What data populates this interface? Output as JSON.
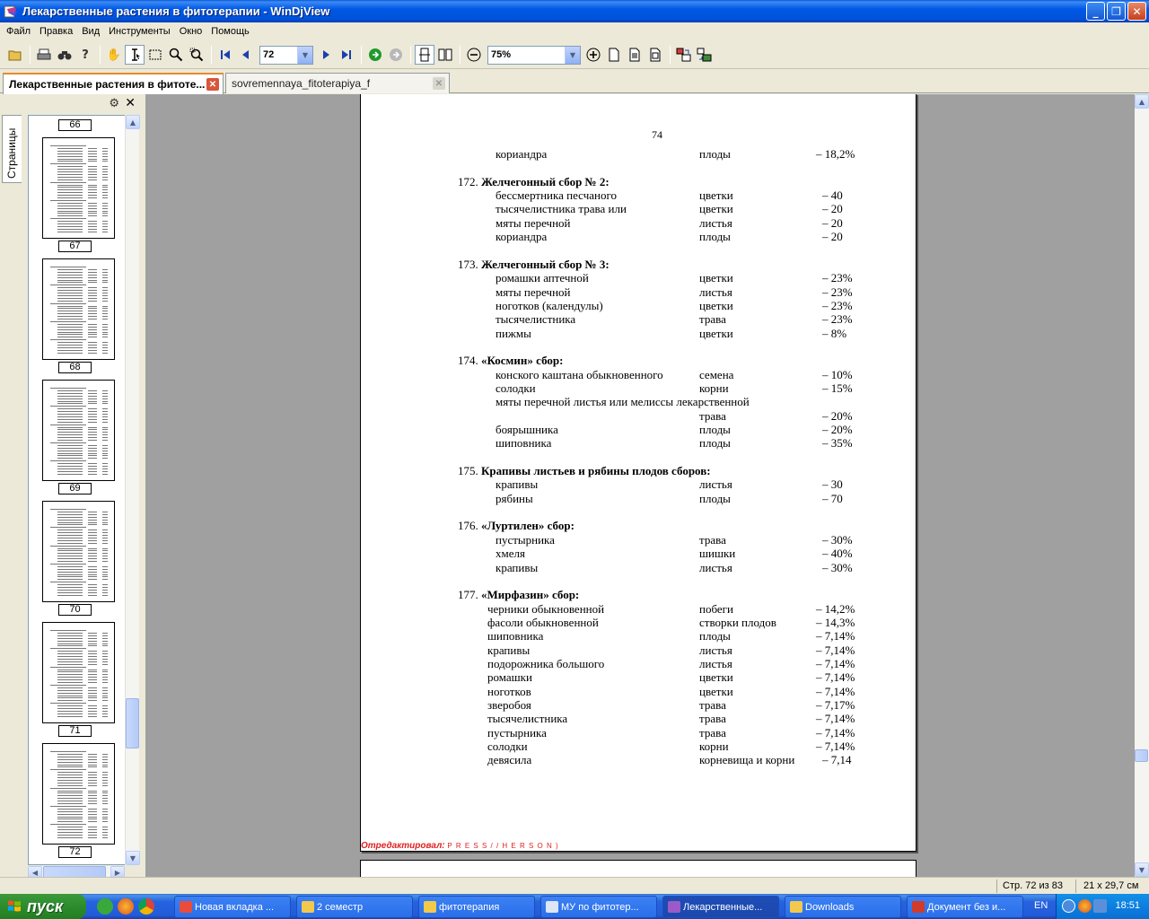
{
  "window": {
    "title": "Лекарственные растения в фитотерапии - WinDjView",
    "minimize": "_",
    "maximize": "❐",
    "close": "✕"
  },
  "menu": [
    "Файл",
    "Правка",
    "Вид",
    "Инструменты",
    "Окно",
    "Помощь"
  ],
  "toolbar": {
    "page_value": "72",
    "zoom_value": "75%"
  },
  "tabs": [
    {
      "label": "Лекарственные растения в фитоте...",
      "active": true
    },
    {
      "label": "sovremennaya_fitoterapiya_f",
      "active": false
    }
  ],
  "sidebar": {
    "tab_label": "Страницы",
    "thumbnails": [
      "66",
      "67",
      "68",
      "69",
      "70",
      "71",
      "72"
    ]
  },
  "document": {
    "page_number": "74",
    "sections": [
      {
        "heading": null,
        "items": [
          {
            "name": "кориандра",
            "part": "плоды",
            "amount": "– 18,2%"
          }
        ]
      },
      {
        "heading_num": "172.",
        "heading": "Желчегонный сбор № 2:",
        "items": [
          {
            "name": "бессмертника песчаного",
            "part": "цветки",
            "amount": "– 40"
          },
          {
            "name": "тысячелистника трава или",
            "part": "цветки",
            "amount": "– 20"
          },
          {
            "name": "мяты перечной",
            "part": "листья",
            "amount": "– 20"
          },
          {
            "name": "кориандра",
            "part": "плоды",
            "amount": "– 20"
          }
        ]
      },
      {
        "heading_num": "173.",
        "heading": "Желчегонный сбор № 3:",
        "items": [
          {
            "name": "ромашки аптечной",
            "part": "цветки",
            "amount": "– 23%"
          },
          {
            "name": "мяты перечной",
            "part": "листья",
            "amount": "– 23%"
          },
          {
            "name": "ноготков (календулы)",
            "part": "цветки",
            "amount": "– 23%"
          },
          {
            "name": "тысячелистника",
            "part": "трава",
            "amount": "– 23%"
          },
          {
            "name": "пижмы",
            "part": "цветки",
            "amount": "– 8%"
          }
        ]
      },
      {
        "heading_num": "174.",
        "heading": "«Космин» сбор:",
        "items": [
          {
            "name": "конского каштана обыкновенного",
            "part": "семена",
            "amount": "– 10%"
          },
          {
            "name": "солодки",
            "part": "корни",
            "amount": "– 15%"
          },
          {
            "name": "мяты перечной листья или мелиссы лекарственной",
            "part": "",
            "amount": ""
          },
          {
            "name": "",
            "part": "трава",
            "amount": "– 20%"
          },
          {
            "name": "боярышника",
            "part": "плоды",
            "amount": "– 20%"
          },
          {
            "name": "шиповника",
            "part": "плоды",
            "amount": "– 35%"
          }
        ]
      },
      {
        "heading_num": "175.",
        "heading": "Крапивы листьев и рябины плодов сборов:",
        "items": [
          {
            "name": "крапивы",
            "part": "листья",
            "amount": "– 30"
          },
          {
            "name": "рябины",
            "part": "плоды",
            "amount": "– 70"
          }
        ]
      },
      {
        "heading_num": "176.",
        "heading": "«Луртилен» сбор:",
        "items": [
          {
            "name": "пустырника",
            "part": "трава",
            "amount": "– 30%"
          },
          {
            "name": "хмеля",
            "part": "шишки",
            "amount": "– 40%"
          },
          {
            "name": "крапивы",
            "part": "листья",
            "amount": "– 30%"
          }
        ]
      },
      {
        "heading_num": "177.",
        "heading": "«Мирфазин» сбор:",
        "items": [
          {
            "name": "черники обыкновенной",
            "part": "побеги",
            "amount": "– 14,2%"
          },
          {
            "name": "фасоли обыкновенной",
            "part": "створки плодов",
            "amount": "– 14,3%"
          },
          {
            "name": "шиповника",
            "part": "плоды",
            "amount": "– 7,14%"
          },
          {
            "name": "крапивы",
            "part": "листья",
            "amount": "– 7,14%"
          },
          {
            "name": "подорожника большого",
            "part": "листья",
            "amount": "– 7,14%"
          },
          {
            "name": "ромашки",
            "part": "цветки",
            "amount": "– 7,14%"
          },
          {
            "name": "ноготков",
            "part": "цветки",
            "amount": "– 7,14%"
          },
          {
            "name": "зверобоя",
            "part": "трава",
            "amount": "– 7,17%"
          },
          {
            "name": "тысячелистника",
            "part": "трава",
            "amount": "– 7,14%"
          },
          {
            "name": "пустырника",
            "part": "трава",
            "amount": "– 7,14%"
          },
          {
            "name": "солодки",
            "part": "корни",
            "amount": "– 7,14%"
          },
          {
            "name": "девясила",
            "part": "корневища и корни",
            "amount": "– 7,14"
          }
        ]
      }
    ],
    "watermark_label": "Отредактировал:",
    "watermark_name": "P R E S S / / H E R S O N )"
  },
  "status": {
    "page_info": "Стр. 72 из 83",
    "paper_size": "21 x 29,7 см"
  },
  "taskbar": {
    "start_label": "пуск",
    "tasks": [
      {
        "label": "Новая вкладка ...",
        "icon": "chrome-icon",
        "color": "#E94B3C"
      },
      {
        "label": "2 семестр",
        "icon": "folder-icon",
        "color": "#F2C94C"
      },
      {
        "label": "фитотерапия",
        "icon": "folder-icon",
        "color": "#F2C94C"
      },
      {
        "label": "МУ по фитотер...",
        "icon": "word-icon",
        "color": "#DCE6F4"
      },
      {
        "label": "Лекарственные...",
        "icon": "windjview-icon",
        "color": "#9B5BC7"
      },
      {
        "label": "Downloads",
        "icon": "folder-icon",
        "color": "#F2C94C"
      },
      {
        "label": "Документ без и...",
        "icon": "pdf-icon",
        "color": "#D13B2A"
      }
    ],
    "language": "EN",
    "clock": "18:51"
  }
}
